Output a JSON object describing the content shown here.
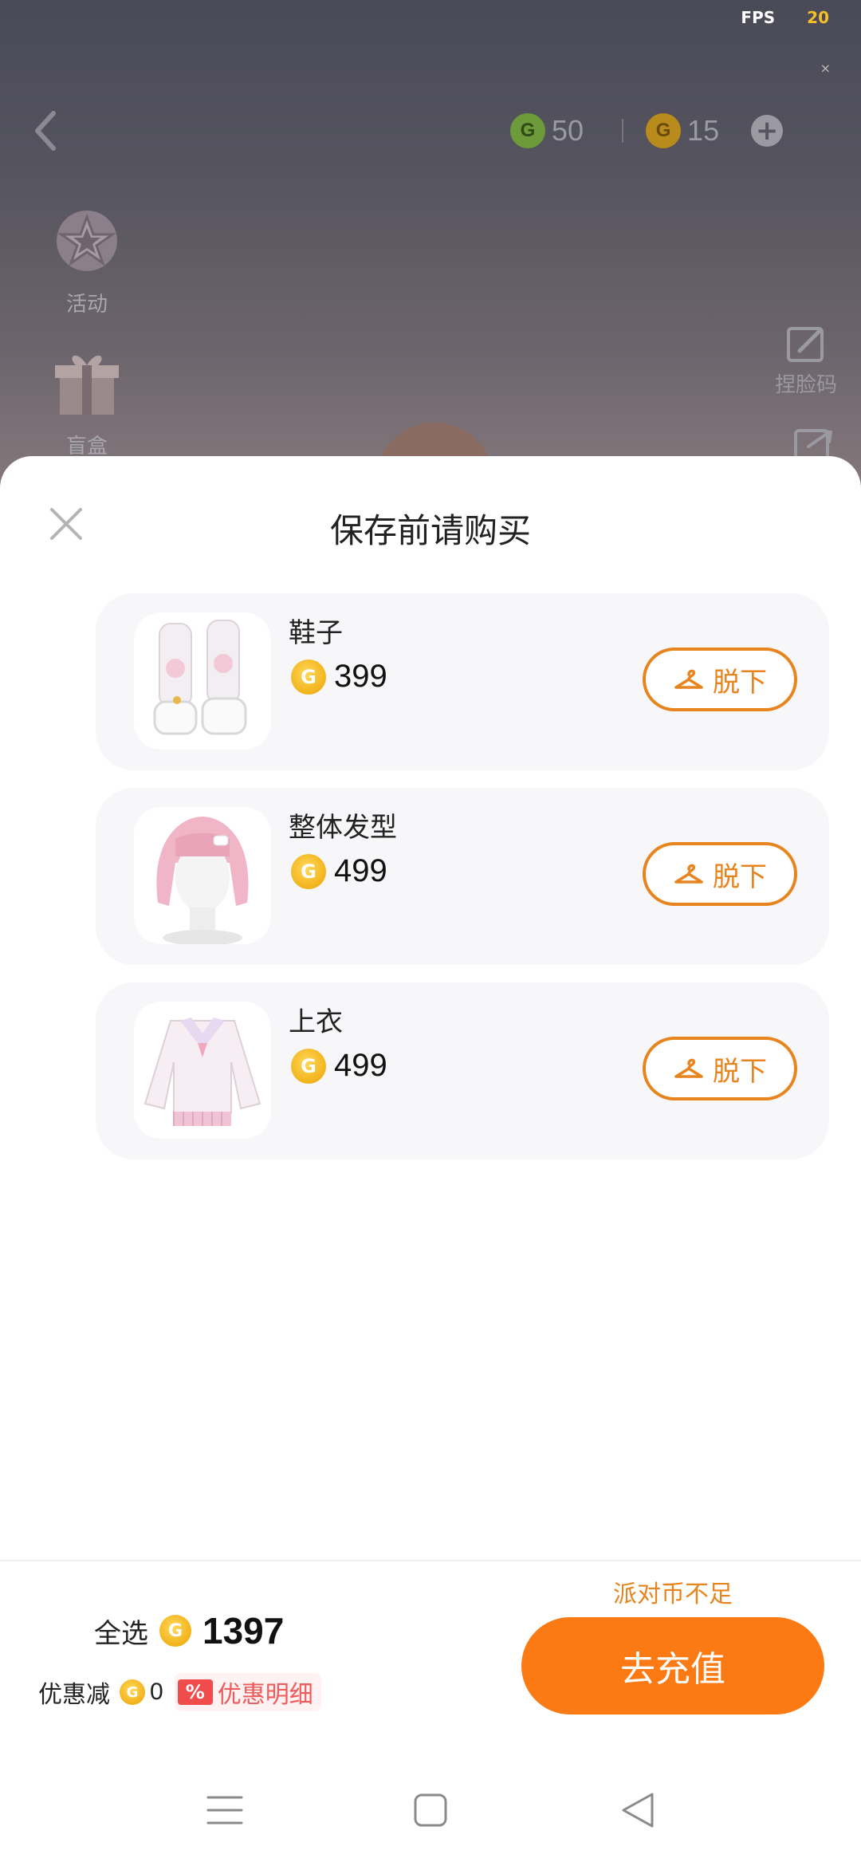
{
  "status": {
    "fps_label": "FPS",
    "fps_value": "20"
  },
  "currency": {
    "green_amount": "50",
    "gold_amount": "15",
    "coin_glyph": "G"
  },
  "side_menu": {
    "activity": "活动",
    "blind_box": "盲盒"
  },
  "right_menu": {
    "face_code": "捏脸码"
  },
  "sheet": {
    "title": "保存前请购买",
    "remove_label": "脱下",
    "items": [
      {
        "name": "鞋子",
        "price": "399",
        "thumb": "shoes"
      },
      {
        "name": "整体发型",
        "price": "499",
        "thumb": "hair"
      },
      {
        "name": "上衣",
        "price": "499",
        "thumb": "top"
      }
    ]
  },
  "footer": {
    "insufficient": "派对币不足",
    "select_all": "全选",
    "total": "1397",
    "discount_label": "优惠减",
    "discount_value": "0",
    "discount_badge": "%",
    "discount_detail": "优惠明细",
    "recharge": "去充值"
  },
  "colors": {
    "accent": "#fb7a14",
    "outline": "#e8841d",
    "discount": "#ef5b5b"
  }
}
